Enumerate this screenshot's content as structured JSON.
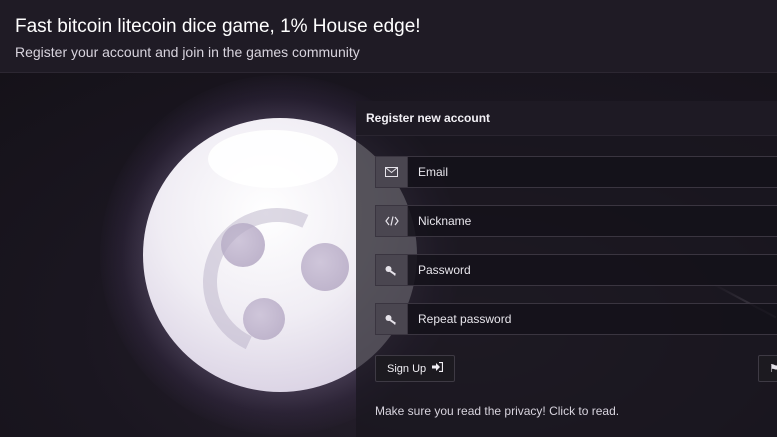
{
  "header": {
    "title": "Fast bitcoin litecoin dice game, 1% House edge!",
    "subtitle": "Register your account and join in the games community"
  },
  "register": {
    "heading": "Register new account",
    "fields": [
      {
        "placeholder": "Email",
        "icon": "envelope-icon"
      },
      {
        "placeholder": "Nickname",
        "icon": "code-icon"
      },
      {
        "placeholder": "Password",
        "icon": "key-icon"
      },
      {
        "placeholder": "Repeat password",
        "icon": "key-icon"
      }
    ],
    "signup_label": "Sign Up",
    "privacy_text": "Make sure you read the privacy! Click to read."
  }
}
